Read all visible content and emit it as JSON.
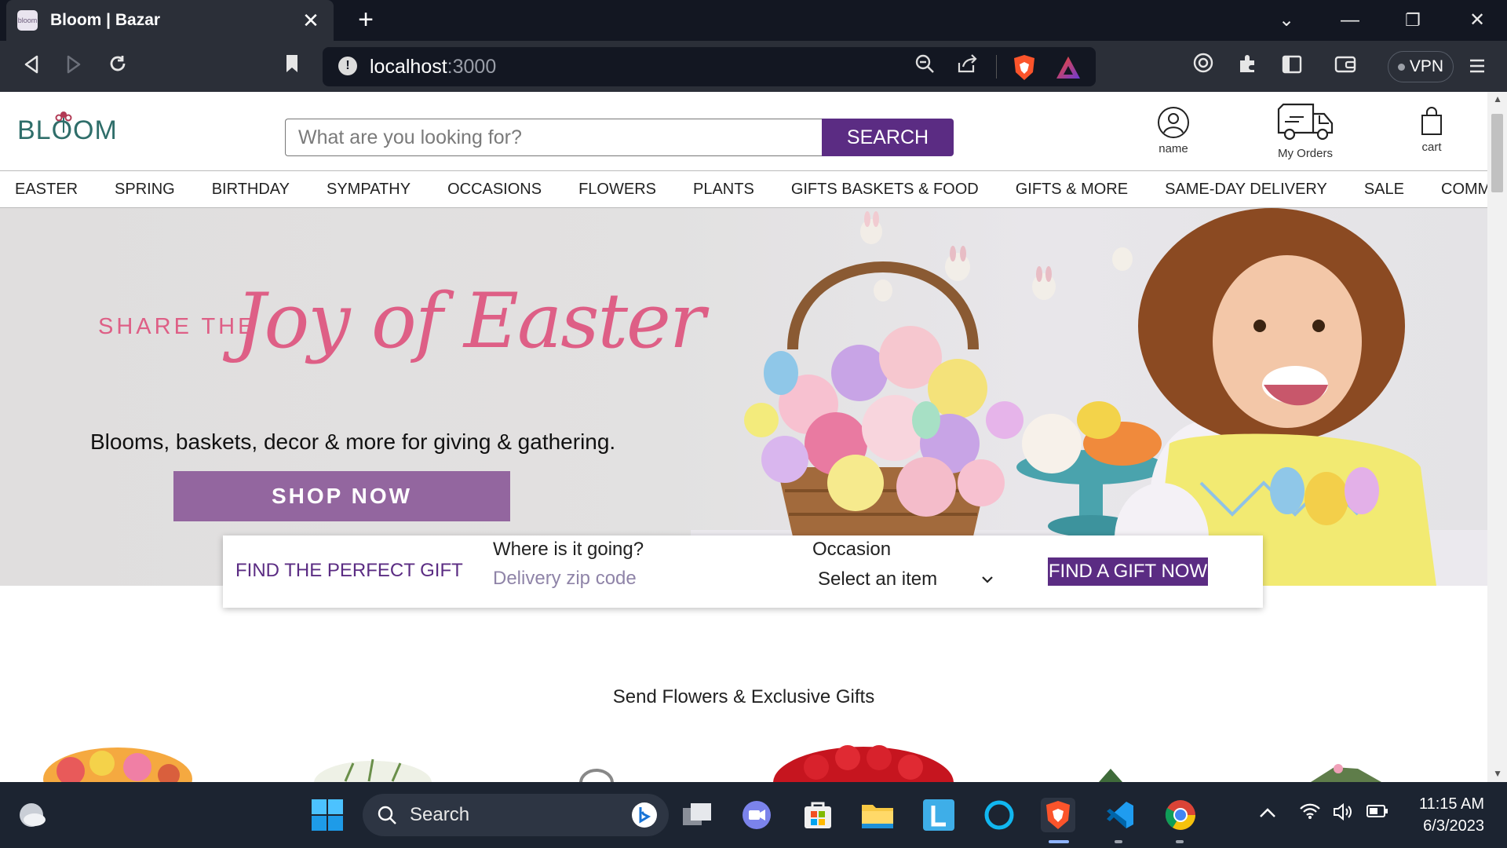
{
  "browser": {
    "tab_title": "Bloom | Bazar",
    "favicon_text": "bloom",
    "url_host": "localhost",
    "url_port": ":3000",
    "vpn_label": "VPN",
    "icons": [
      "back-icon",
      "forward-icon",
      "reload-icon",
      "bookmark-icon",
      "info-icon",
      "zoom-out-icon",
      "share-icon",
      "brave-shield-icon",
      "brave-rewards-icon",
      "wallet-icon",
      "extensions-icon",
      "sidebar-icon",
      "menu-icon"
    ]
  },
  "header": {
    "logo_text": "BLOOM",
    "search_placeholder": "What are you looking for?",
    "search_button": "SEARCH",
    "account_label": "name",
    "orders_label": "My Orders",
    "cart_label": "cart"
  },
  "nav": {
    "items": [
      "EASTER",
      "SPRING",
      "BIRTHDAY",
      "SYMPATHY",
      "OCCASIONS",
      "FLOWERS",
      "PLANTS",
      "GIFTS BASKETS & FOOD",
      "GIFTS & MORE",
      "SAME-DAY DELIVERY",
      "SALE",
      "COMMUNITY"
    ]
  },
  "hero": {
    "share_the": "SHARE THE",
    "script_title": "Joy of Easter",
    "subtitle": "Blooms, baskets, decor & more for giving & gathering.",
    "cta": "SHOP NOW",
    "colors": {
      "accent_pink": "#de5f86",
      "button_purple": "#93669f"
    }
  },
  "gift_finder": {
    "title": "FIND THE PERFECT GIFT",
    "zip_label": "Where is it going?",
    "zip_placeholder": "Delivery zip code",
    "occasion_label": "Occasion",
    "occasion_selected": "Select an item",
    "button": "FIND A GIFT NOW"
  },
  "section": {
    "title": "Send Flowers & Exclusive Gifts"
  },
  "taskbar": {
    "search_label": "Search",
    "time": "11:15 AM",
    "date": "6/3/2023"
  },
  "theme": {
    "brand_purple": "#5b2c83",
    "logo_teal": "#2f6e6a"
  }
}
